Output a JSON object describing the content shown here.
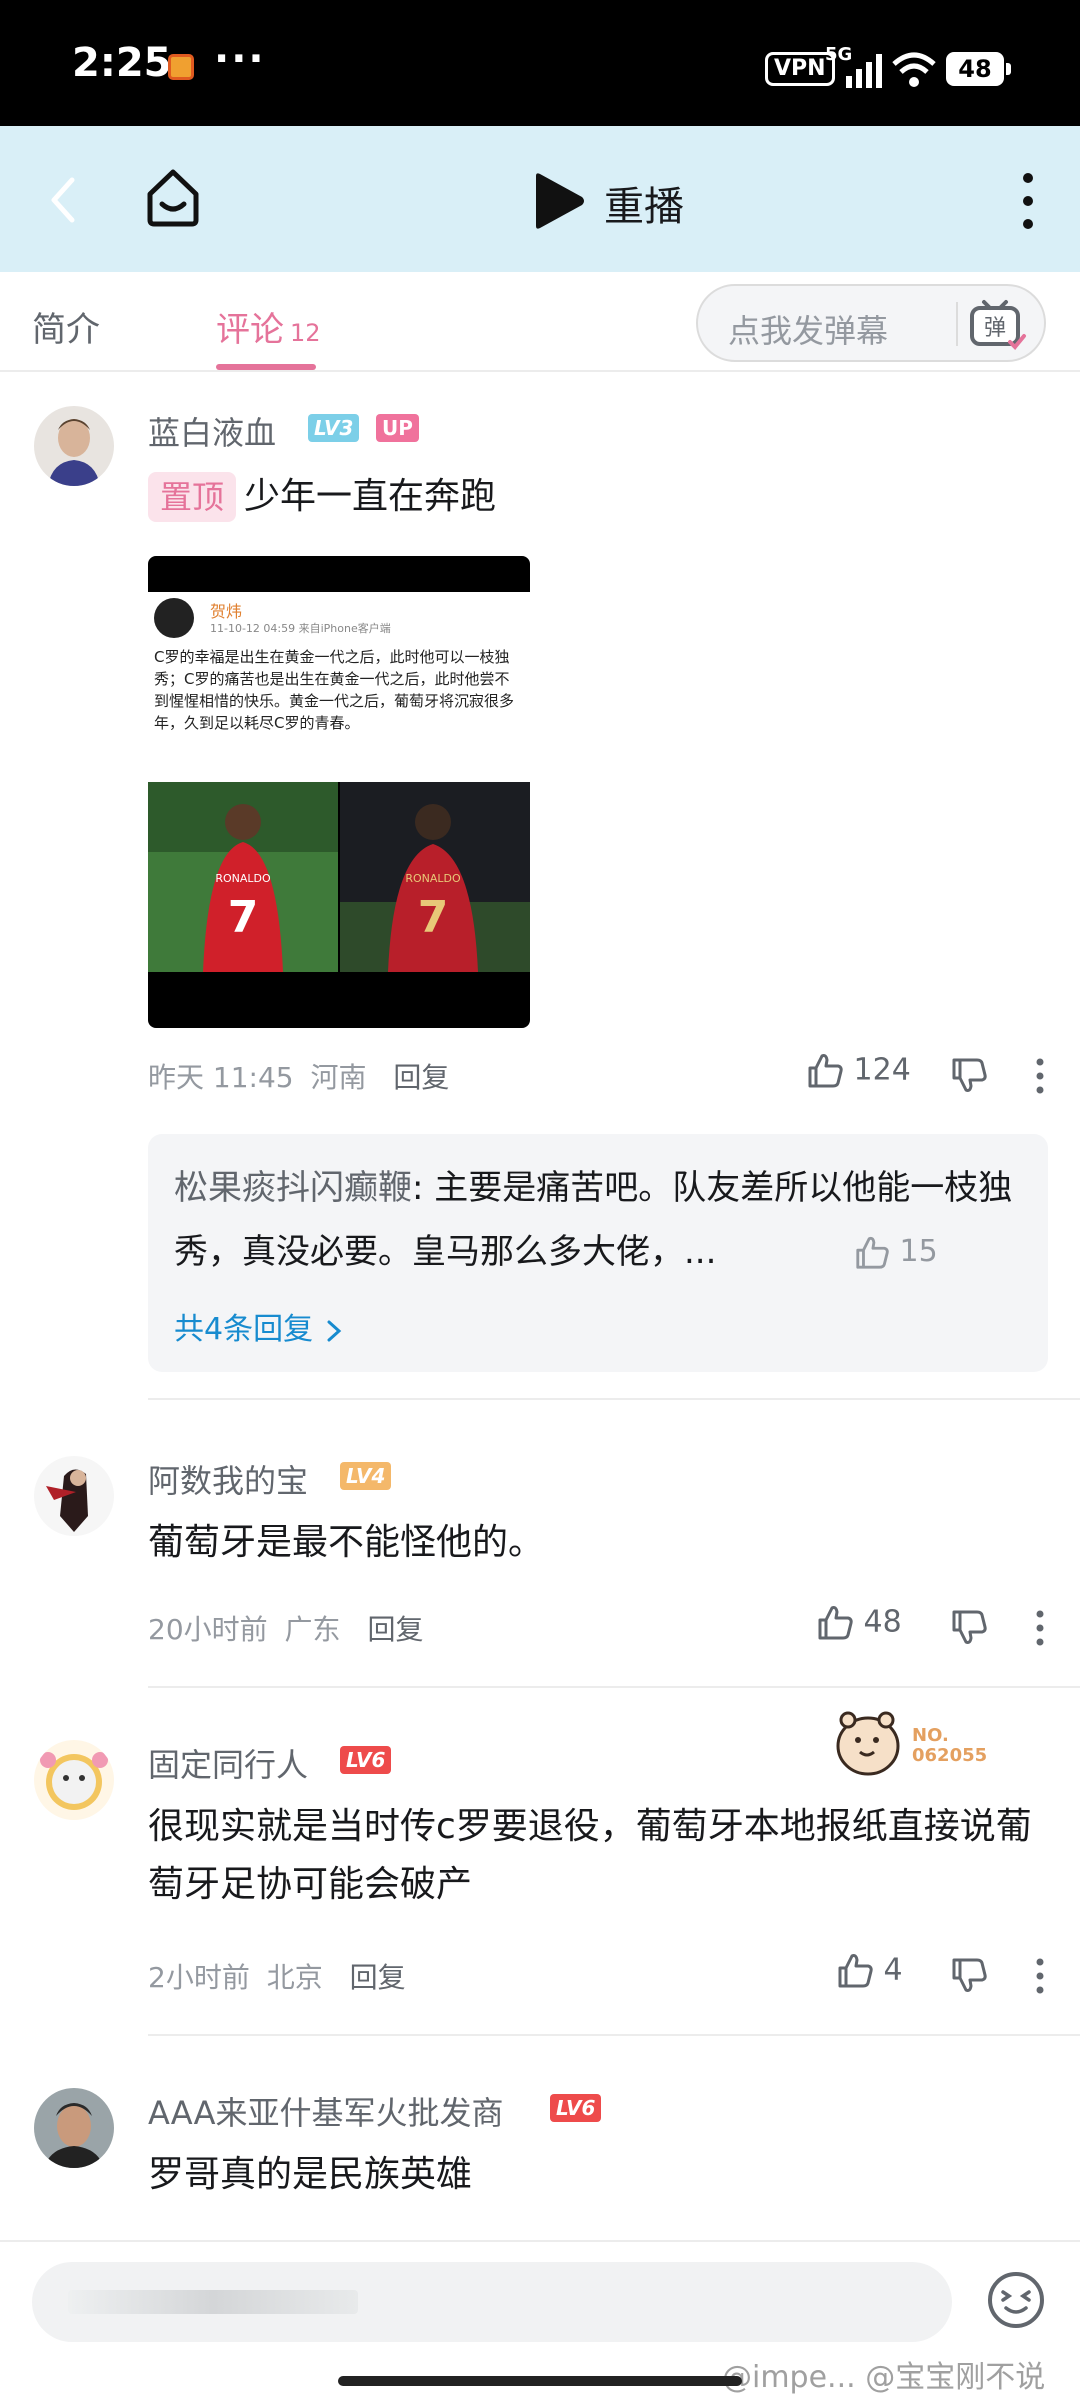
{
  "status_bar": {
    "time": "2:25",
    "dots": "···",
    "vpn": "VPN",
    "network": "5G",
    "battery": "48"
  },
  "header": {
    "replay_label": "重播"
  },
  "tabs": {
    "intro": "简介",
    "comments": "评论",
    "comments_count": "12",
    "danmaku_placeholder": "点我发弹幕",
    "danmaku_icon_label": "弹"
  },
  "comments": [
    {
      "username": "蓝白液血",
      "level": "LV3",
      "up_badge": "UP",
      "pin_label": "置顶",
      "text": "少年一直在奔跑",
      "image": {
        "author": "贺炜",
        "date": "11-10-12 04:59  来自iPhone客户端",
        "body": "C罗的幸福是出生在黄金一代之后，此时他可以一枝独秀；C罗的痛苦也是出生在黄金一代之后，此时他尝不到惺惺相惜的快乐。黄金一代之后，葡萄牙将沉寂很多年，久到足以耗尽C罗的青春。",
        "shirt_name": "RONALDO",
        "shirt_number": "7"
      },
      "time": "昨天 11:45",
      "location": "河南",
      "reply": "回复",
      "likes": "124",
      "sub_reply": {
        "user": "松果痰抖闪癫鞭",
        "text": "主要是痛苦吧。队友差所以他能一枝独秀，真没必要。皇马那么多大佬，...",
        "likes": "15",
        "more": "共4条回复"
      }
    },
    {
      "username": "阿数我的宝",
      "level": "LV4",
      "text": "葡萄牙是最不能怪他的。",
      "time": "20小时前",
      "location": "广东",
      "reply": "回复",
      "likes": "48"
    },
    {
      "username": "固定同行人",
      "level": "LV6",
      "badge_no": "NO.\n062055",
      "text": "很现实就是当时传c罗要退役，葡萄牙本地报纸直接说葡萄牙足协可能会破产",
      "time": "2小时前",
      "location": "北京",
      "reply": "回复",
      "likes": "4"
    },
    {
      "username": "AAA来亚什基军火批发商",
      "level": "LV6",
      "text": "罗哥真的是民族英雄"
    }
  ],
  "watermark": "@impe... @宝宝刚不说",
  "colors": {
    "accent_pink": "#e5739a",
    "header_bg": "#d9eff7",
    "link_blue": "#178bcf"
  }
}
